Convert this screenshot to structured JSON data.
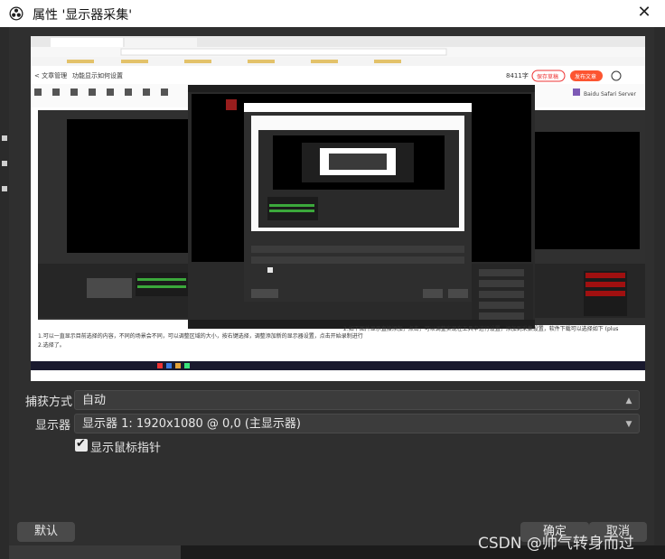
{
  "window": {
    "title": "属性 '显示器采集'",
    "close_label": "✕"
  },
  "preview": {
    "browser_top_link": "< 文章管理",
    "browser_doc_title": "功能显示如何设置",
    "browser_word_count": "8411字",
    "browser_publish_button": "保存草稿",
    "browser_ai_button": "发布文章",
    "inner_window_label": "Baidu Safari Server",
    "doc_line_1": "1.可以一直显示目前选择的内容，不同的场景会不同，可以调整区域的大小，按右键选择，调整添加新的显示器设置，点击开始录制进行",
    "doc_line_2": "2.如下图片显示直接添加，点击，可以调整实现在工具中进行设置，添加到采集设置，软件下载可以选择如下 (plus",
    "doc_line_3": "2.选择了。"
  },
  "form": {
    "capture_method_label": "捕获方式",
    "capture_method_value": "自动",
    "display_label": "显示器",
    "display_value": "显示器 1: 1920x1080 @ 0,0 (主显示器)",
    "show_cursor_label": "显示鼠标指针",
    "show_cursor_checked": true
  },
  "buttons": {
    "defaults": "默认",
    "ok": "确定",
    "cancel": "取消"
  },
  "watermark": "CSDN @帅气转身而过",
  "colors": {
    "dialog_bg": "#2f2f2f",
    "combo_bg": "#3c3c3c",
    "button_bg": "#4a4a4a",
    "text": "#e6e6e6"
  }
}
